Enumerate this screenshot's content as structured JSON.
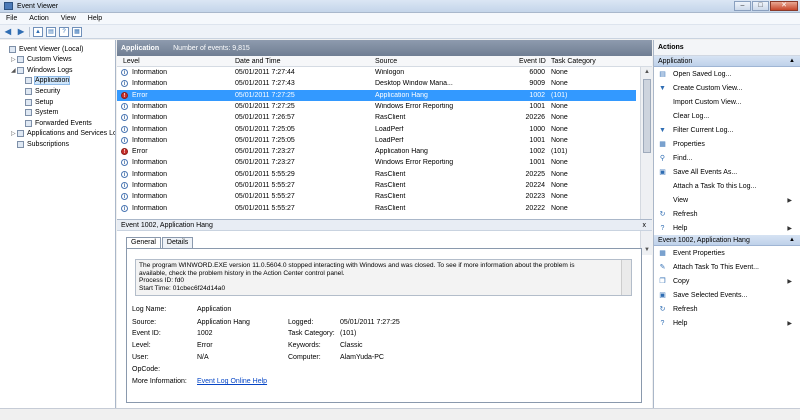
{
  "window": {
    "title": "Event Viewer",
    "min": "–",
    "max": "□",
    "close": "✕"
  },
  "menu": [
    "File",
    "Action",
    "View",
    "Help"
  ],
  "tree": [
    {
      "label": "Event Viewer (Local)",
      "indent": 0,
      "exp": ""
    },
    {
      "label": "Custom Views",
      "indent": 1,
      "exp": "▷"
    },
    {
      "label": "Windows Logs",
      "indent": 1,
      "exp": "◢"
    },
    {
      "label": "Application",
      "indent": 2,
      "exp": "",
      "selected": true
    },
    {
      "label": "Security",
      "indent": 2,
      "exp": ""
    },
    {
      "label": "Setup",
      "indent": 2,
      "exp": ""
    },
    {
      "label": "System",
      "indent": 2,
      "exp": ""
    },
    {
      "label": "Forwarded Events",
      "indent": 2,
      "exp": ""
    },
    {
      "label": "Applications and Services Lo",
      "indent": 1,
      "exp": "▷"
    },
    {
      "label": "Subscriptions",
      "indent": 1,
      "exp": ""
    }
  ],
  "center": {
    "log_name": "Application",
    "event_count": "Number of events: 9,815",
    "columns": [
      "Level",
      "Date and Time",
      "Source",
      "Event ID",
      "Task Category"
    ],
    "events": [
      {
        "level": "Information",
        "type": "info",
        "date": "05/01/2011 7:27:44",
        "source": "Winlogon",
        "id": "6000",
        "task": "None"
      },
      {
        "level": "Information",
        "type": "info",
        "date": "05/01/2011 7:27:43",
        "source": "Desktop Window Mana...",
        "id": "9009",
        "task": "None"
      },
      {
        "level": "Error",
        "type": "err",
        "date": "05/01/2011 7:27:25",
        "source": "Application Hang",
        "id": "1002",
        "task": "(101)",
        "selected": true
      },
      {
        "level": "Information",
        "type": "info",
        "date": "05/01/2011 7:27:25",
        "source": "Windows Error Reporting",
        "id": "1001",
        "task": "None"
      },
      {
        "level": "Information",
        "type": "info",
        "date": "05/01/2011 7:26:57",
        "source": "RasClient",
        "id": "20226",
        "task": "None"
      },
      {
        "level": "Information",
        "type": "info",
        "date": "05/01/2011 7:25:05",
        "source": "LoadPerf",
        "id": "1000",
        "task": "None"
      },
      {
        "level": "Information",
        "type": "info",
        "date": "05/01/2011 7:25:05",
        "source": "LoadPerf",
        "id": "1001",
        "task": "None"
      },
      {
        "level": "Error",
        "type": "err",
        "date": "05/01/2011 7:23:27",
        "source": "Application Hang",
        "id": "1002",
        "task": "(101)"
      },
      {
        "level": "Information",
        "type": "info",
        "date": "05/01/2011 7:23:27",
        "source": "Windows Error Reporting",
        "id": "1001",
        "task": "None"
      },
      {
        "level": "Information",
        "type": "info",
        "date": "05/01/2011 5:55:29",
        "source": "RasClient",
        "id": "20225",
        "task": "None"
      },
      {
        "level": "Information",
        "type": "info",
        "date": "05/01/2011 5:55:27",
        "source": "RasClient",
        "id": "20224",
        "task": "None"
      },
      {
        "level": "Information",
        "type": "info",
        "date": "05/01/2011 5:55:27",
        "source": "RasClient",
        "id": "20223",
        "task": "None"
      },
      {
        "level": "Information",
        "type": "info",
        "date": "05/01/2011 5:55:27",
        "source": "RasClient",
        "id": "20222",
        "task": "None"
      }
    ]
  },
  "detail": {
    "title": "Event 1002, Application Hang",
    "close": "x",
    "tabs": [
      "General",
      "Details"
    ],
    "message_lines": [
      "The program WINWORD.EXE version 11.0.5604.0 stopped interacting with Windows and was closed. To see if more information about the problem is",
      "available, check the problem history in the Action Center control panel.",
      "Process ID: fd0",
      "Start Time: 01cbec6f24d14a0"
    ],
    "fields": {
      "log_name_label": "Log Name:",
      "log_name": "Application",
      "source_label": "Source:",
      "source": "Application Hang",
      "logged_label": "Logged:",
      "logged": "05/01/2011 7:27:25",
      "event_id_label": "Event ID:",
      "event_id": "1002",
      "task_label": "Task Category:",
      "task": "(101)",
      "level_label": "Level:",
      "level": "Error",
      "keywords_label": "Keywords:",
      "keywords": "Classic",
      "user_label": "User:",
      "user": "N/A",
      "computer_label": "Computer:",
      "computer": "AlamYuda-PC",
      "opcode_label": "OpCode:",
      "more_info_label": "More Information:",
      "more_info_link": "Event Log Online Help"
    }
  },
  "actions": {
    "title": "Actions",
    "section1": "Application",
    "items1": [
      {
        "label": "Open Saved Log...",
        "icon": "folder-icon",
        "glyph": "▤"
      },
      {
        "label": "Create Custom View...",
        "icon": "filter-icon",
        "glyph": "▼"
      },
      {
        "label": "Import Custom View...",
        "icon": "blank-icon",
        "glyph": ""
      },
      {
        "label": "Clear Log...",
        "icon": "blank-icon",
        "glyph": ""
      },
      {
        "label": "Filter Current Log...",
        "icon": "filter-icon",
        "glyph": "▼"
      },
      {
        "label": "Properties",
        "icon": "properties-icon",
        "glyph": "▦"
      },
      {
        "label": "Find...",
        "icon": "find-icon",
        "glyph": "⚲"
      },
      {
        "label": "Save All Events As...",
        "icon": "save-icon",
        "glyph": "▣"
      },
      {
        "label": "Attach a Task To this Log...",
        "icon": "blank-icon",
        "glyph": ""
      },
      {
        "label": "View",
        "icon": "blank-icon",
        "glyph": "",
        "submenu": "▶"
      },
      {
        "label": "Refresh",
        "icon": "refresh-icon",
        "glyph": "↻"
      },
      {
        "label": "Help",
        "icon": "help-icon",
        "glyph": "?",
        "submenu": "▶"
      }
    ],
    "section2": "Event 1002, Application Hang",
    "items2": [
      {
        "label": "Event Properties",
        "icon": "properties-icon",
        "glyph": "▦"
      },
      {
        "label": "Attach Task To This Event...",
        "icon": "task-icon",
        "glyph": "✎"
      },
      {
        "label": "Copy",
        "icon": "copy-icon",
        "glyph": "❐",
        "submenu": "▶"
      },
      {
        "label": "Save Selected Events...",
        "icon": "save-icon",
        "glyph": "▣"
      },
      {
        "label": "Refresh",
        "icon": "refresh-icon",
        "glyph": "↻"
      },
      {
        "label": "Help",
        "icon": "help-icon",
        "glyph": "?",
        "submenu": "▶"
      }
    ]
  }
}
